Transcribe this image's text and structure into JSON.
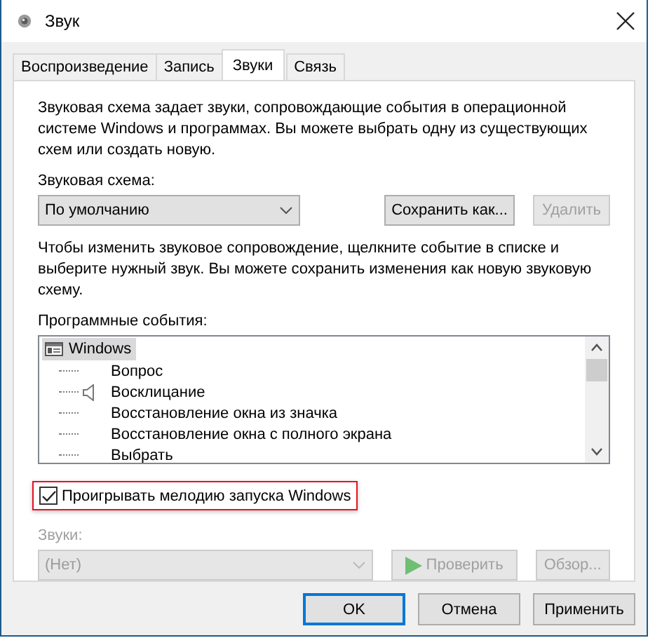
{
  "window": {
    "title": "Звук"
  },
  "tabs": [
    {
      "label": "Воспроизведение",
      "selected": false
    },
    {
      "label": "Запись",
      "selected": false
    },
    {
      "label": "Звуки",
      "selected": true
    },
    {
      "label": "Связь",
      "selected": false
    }
  ],
  "description": "Звуковая схема задает звуки, сопровождающие события в операционной системе Windows и программах. Вы можете выбрать одну из существующих схем или создать новую.",
  "scheme": {
    "label": "Звуковая схема:",
    "value": "По умолчанию",
    "buttons": [
      {
        "label": "Сохранить как...",
        "disabled": false
      },
      {
        "label": "Удалить",
        "disabled": true
      }
    ]
  },
  "instructions": "Чтобы изменить звуковое сопровождение, щелкните событие в списке и выберите нужный звук. Вы можете сохранить изменения как новую звуковую схему.",
  "events": {
    "label": "Программные события:",
    "tree": [
      {
        "label": "Windows",
        "selected": true,
        "children": [
          {
            "label": "Вопрос",
            "has_sound": false
          },
          {
            "label": "Восклицание",
            "has_sound": true
          },
          {
            "label": "Восстановление окна из значка",
            "has_sound": false
          },
          {
            "label": "Восстановление окна с полного экрана",
            "has_sound": false
          },
          {
            "label": "Выбрать",
            "has_sound": false
          }
        ]
      }
    ]
  },
  "startup": {
    "label": "Проигрывать мелодию запуска Windows",
    "checked": true,
    "highlighted": true
  },
  "sounds": {
    "label": "Звуки:",
    "value": "(Нет)",
    "disabled": true,
    "test_button": {
      "label": "Проверить",
      "disabled": true
    },
    "browse_button": {
      "label": "Обзор...",
      "disabled": true
    }
  },
  "footer": [
    {
      "label": "OK",
      "default": true
    },
    {
      "label": "Отмена",
      "default": false
    },
    {
      "label": "Применить",
      "default": false
    }
  ]
}
